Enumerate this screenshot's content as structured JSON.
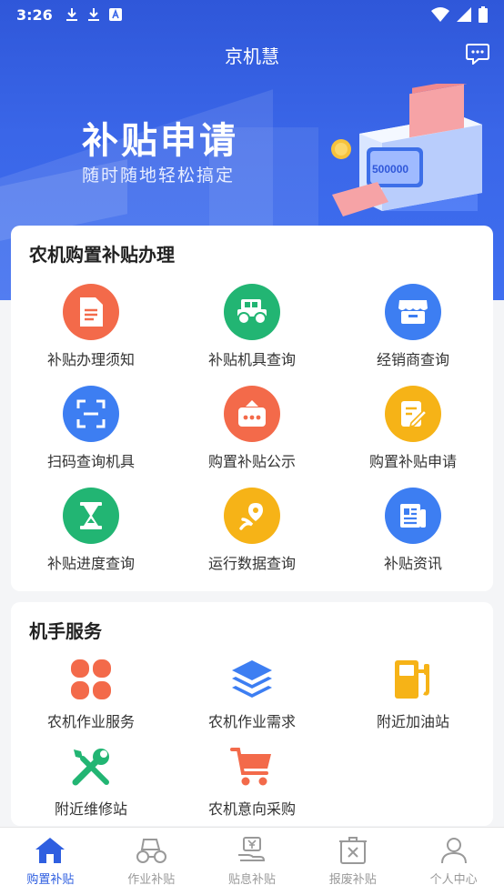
{
  "status_bar": {
    "time": "3:26",
    "icons": [
      "download-icon",
      "download-icon",
      "a-icon",
      "wifi-icon",
      "signal-icon",
      "battery-icon"
    ]
  },
  "header": {
    "title": "京机慧",
    "message_icon": "message-icon"
  },
  "banner": {
    "title": "补贴申请",
    "subtitle": "随时随地轻松搞定",
    "amount": "500000"
  },
  "subsidy_section": {
    "title": "农机购置补贴办理",
    "items": [
      {
        "label": "补贴办理须知",
        "icon": "document-icon",
        "color": "#f36a4a"
      },
      {
        "label": "补贴机具查询",
        "icon": "tractor-icon",
        "color": "#22b573"
      },
      {
        "label": "经销商查询",
        "icon": "store-icon",
        "color": "#3d7ef2"
      },
      {
        "label": "扫码查询机具",
        "icon": "scan-icon",
        "color": "#3d7ef2"
      },
      {
        "label": "购置补贴公示",
        "icon": "notice-board-icon",
        "color": "#f36a4a"
      },
      {
        "label": "购置补贴申请",
        "icon": "edit-form-icon",
        "color": "#f6b317"
      },
      {
        "label": "补贴进度查询",
        "icon": "hourglass-icon",
        "color": "#22b573"
      },
      {
        "label": "运行数据查询",
        "icon": "location-route-icon",
        "color": "#f6b317"
      },
      {
        "label": "补贴资讯",
        "icon": "news-icon",
        "color": "#3d7ef2"
      }
    ]
  },
  "operator_section": {
    "title": "机手服务",
    "items": [
      {
        "label": "农机作业服务",
        "icon": "clover-icon",
        "color": "#f36a4a"
      },
      {
        "label": "农机作业需求",
        "icon": "layers-icon",
        "color": "#3d7ef2"
      },
      {
        "label": "附近加油站",
        "icon": "fuel-pump-icon",
        "color": "#f6b317"
      },
      {
        "label": "附近维修站",
        "icon": "wrench-screwdriver-icon",
        "color": "#22b573"
      },
      {
        "label": "农机意向采购",
        "icon": "shopping-cart-icon",
        "color": "#f36a4a"
      }
    ]
  },
  "bottom_nav": {
    "items": [
      {
        "label": "购置补贴",
        "icon": "home-icon",
        "active": true
      },
      {
        "label": "作业补贴",
        "icon": "tractor-outline-icon",
        "active": false
      },
      {
        "label": "贴息补贴",
        "icon": "yuan-hand-icon",
        "active": false
      },
      {
        "label": "报废补贴",
        "icon": "trash-box-icon",
        "active": false
      },
      {
        "label": "个人中心",
        "icon": "user-icon",
        "active": false
      }
    ]
  },
  "colors": {
    "primary": "#2f5fe0",
    "orange": "#f36a4a",
    "green": "#22b573",
    "blue": "#3d7ef2",
    "yellow": "#f6b317"
  }
}
